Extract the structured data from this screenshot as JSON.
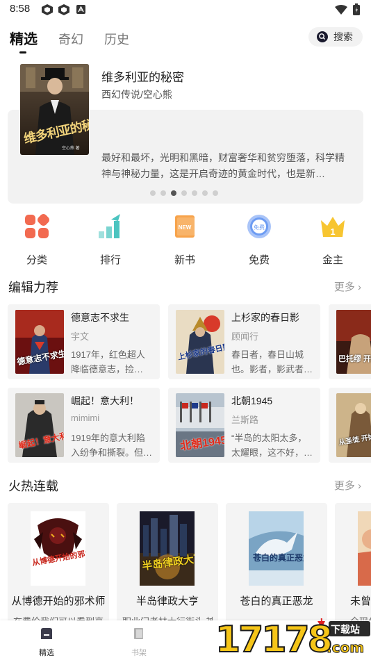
{
  "status_bar": {
    "time": "8:58"
  },
  "tabs": [
    {
      "label": "精选",
      "active": true
    },
    {
      "label": "奇幻",
      "active": false
    },
    {
      "label": "历史",
      "active": false
    }
  ],
  "search": {
    "label": "搜索",
    "icon": "search-icon"
  },
  "hero": {
    "title": "维多利亚的秘密",
    "subtitle": "西幻传说/空心熊",
    "description": "最好和最坏，光明和黑暗，财富奢华和贫穷堕落，科学精神与神秘力量，这是开启奇迹的黄金时代，也是新…",
    "cover_text": "维多利亚的秘密",
    "cover_author": "空心熊 著",
    "page_count": 7,
    "active_page": 3
  },
  "categories": [
    {
      "label": "分类",
      "icon": "grid-icon",
      "color": "#f26a50"
    },
    {
      "label": "排行",
      "icon": "ranking-icon",
      "color": "#4bc4c0"
    },
    {
      "label": "新书",
      "icon": "new-book-icon",
      "color": "#f7a34b"
    },
    {
      "label": "免费",
      "icon": "free-badge-icon",
      "color": "#6d9cf2"
    },
    {
      "label": "金主",
      "icon": "crown-icon",
      "color": "#f7c531"
    }
  ],
  "editor_picks": {
    "title": "编辑力荐",
    "more": "更多",
    "items": [
      {
        "title": "德意志不求生",
        "author": "宇文",
        "desc": "1917年，红色超人降临德意志，捡…",
        "cover_text": "德意志不求生"
      },
      {
        "title": "上杉家的春日影",
        "author": "顾闻行",
        "desc": "春日者，春日山城也。影者，影武者…",
        "cover_text": "上杉家的春日影"
      },
      {
        "title": "",
        "author": "",
        "desc": "",
        "cover_text": "巴托缪 开航"
      },
      {
        "title": "崛起！意大利！",
        "author": "mimimi",
        "desc": "1919年的意大利陷入纷争和撕裂。但…",
        "cover_text": "崛起！意大利！"
      },
      {
        "title": "北朝1945",
        "author": "兰斯路",
        "desc": "“半岛的太阳太多，太耀眼，这不好，…",
        "cover_text": "北朝1945"
      },
      {
        "title": "",
        "author": "",
        "desc": "",
        "cover_text": "从圣徒 开始"
      }
    ]
  },
  "hot_serial": {
    "title": "火热连载",
    "more": "更多",
    "items": [
      {
        "title": "从博德开始的邪术师",
        "desc": "在费伦我们可以看到高",
        "cover_text": "从博德开始的邪术师"
      },
      {
        "title": "半岛律政大亨",
        "desc": "职业门老林士行街头 神",
        "cover_text": "半岛律政大亨"
      },
      {
        "title": "苍白的真正恶龙",
        "desc": "",
        "cover_text": "苍白的真正恶龙"
      },
      {
        "title": "未曾",
        "desc": "全现代",
        "cover_text": ""
      }
    ]
  },
  "bottom_nav": [
    {
      "label": "精选",
      "icon": "home-icon",
      "active": true,
      "color": "#222222"
    },
    {
      "label": "书架",
      "icon": "bookshelf-icon",
      "active": false,
      "color": "#b0b0b0"
    }
  ],
  "watermark": {
    "text": "17178",
    "suffix": ".com",
    "badge": "下载站"
  }
}
